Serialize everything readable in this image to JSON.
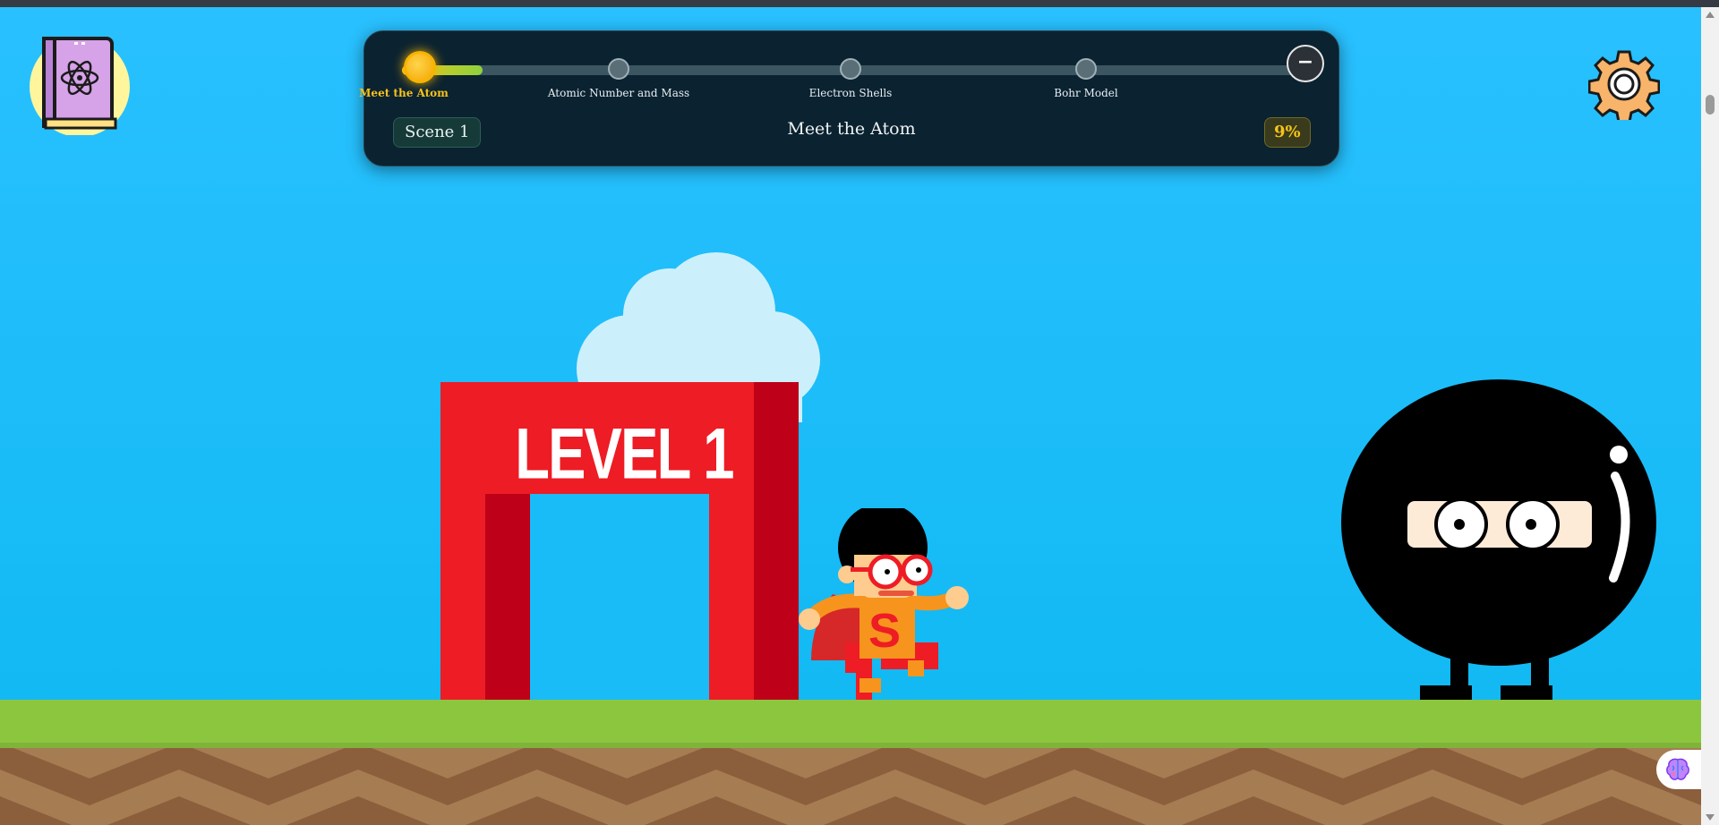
{
  "progress": {
    "steps": [
      {
        "label": "Meet the Atom",
        "active": true
      },
      {
        "label": "Atomic Number and Mass",
        "active": false
      },
      {
        "label": "Electron Shells",
        "active": false
      },
      {
        "label": "Bohr Model",
        "active": false
      }
    ],
    "end_symbol": "−",
    "fill_fraction": 0.09,
    "scene_label": "Scene 1",
    "scene_title": "Meet the Atom",
    "percent": "9%"
  },
  "gate": {
    "text": "LEVEL 1"
  },
  "hero": {
    "emblem": "S"
  },
  "icons": {
    "book": "atom-book-icon",
    "settings": "gear-icon",
    "assistant": "brain-icon"
  },
  "colors": {
    "sky": "#29c0ff",
    "grass": "#8cc63f",
    "dirt_light": "#a67c52",
    "dirt_dark": "#8b5e3c",
    "gate_red": "#ee1c25",
    "gate_shadow": "#be0018",
    "accent_yellow": "#f5c518",
    "panel": "#0b2230"
  }
}
